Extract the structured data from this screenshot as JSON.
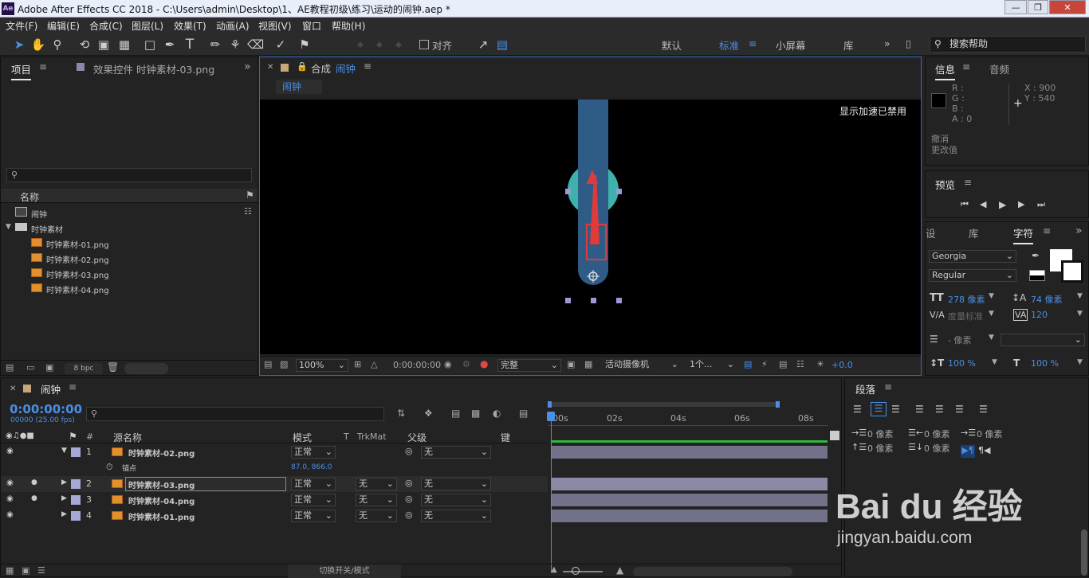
{
  "window": {
    "title": "Adobe After Effects CC 2018 - C:\\Users\\admin\\Desktop\\1、AE教程初级\\练习\\运动的闹钟.aep *",
    "logo": "Ae"
  },
  "menu": [
    "文件(F)",
    "编辑(E)",
    "合成(C)",
    "图层(L)",
    "效果(T)",
    "动画(A)",
    "视图(V)",
    "窗口",
    "帮助(H)"
  ],
  "toolbar": {
    "align_label": "对齐",
    "workspaces": [
      "默认",
      "标准",
      "小屏幕",
      "库"
    ],
    "active_workspace": "标准",
    "search_placeholder": "搜索帮助"
  },
  "project": {
    "tab_project": "项目",
    "tab_effects": "效果控件 时钟素材-03.png",
    "col_name": "名称",
    "items": [
      {
        "name": "闹钟",
        "type": "comp"
      },
      {
        "name": "时钟素材",
        "type": "folder"
      }
    ],
    "files": [
      "时钟素材-01.png",
      "时钟素材-02.png",
      "时钟素材-03.png",
      "时钟素材-04.png"
    ],
    "bpc": "8 bpc"
  },
  "comp": {
    "tab_prefix": "合成",
    "tab_name": "闹钟",
    "breadcrumb": "闹钟",
    "accel_notice": "显示加速已禁用",
    "zoom": "100%",
    "timecode": "0:00:00:00",
    "quality": "完整",
    "camera": "活动摄像机",
    "views": "1个...",
    "exposure": "+0.0"
  },
  "info": {
    "tab_info": "信息",
    "tab_audio": "音频",
    "r": "R :",
    "g": "G :",
    "b": "B :",
    "a": "A :  0",
    "x": "X : 900",
    "y": "Y : 540",
    "undo": "撤消",
    "undo_detail": "更改值"
  },
  "preview": {
    "title": "预览"
  },
  "character": {
    "tab_set": "设",
    "tab_lib": "库",
    "tab_char": "字符",
    "font": "Georgia",
    "style": "Regular",
    "size": "278 像素",
    "leading": "74 像素",
    "kerning": "度量标准",
    "tracking": "120",
    "stroke": "- 像素",
    "vscale": "100 %",
    "hscale": "100 %"
  },
  "paragraph": {
    "title": "段落",
    "indent1": "0 像素",
    "indent2": "0 像素",
    "indent3": "0 像素",
    "space1": "0 像素",
    "space2": "0 像素"
  },
  "timeline": {
    "tab": "闹钟",
    "timecode": "0:00:00:00",
    "fps": "00000 (25.00 fps)",
    "col_num": "#",
    "col_source": "源名称",
    "col_mode": "模式",
    "col_t": "T",
    "col_trkmat": "TrkMat",
    "col_parent": "父级",
    "col_key": "键",
    "ruler": [
      "00s",
      "02s",
      "04s",
      "06s",
      "08s"
    ],
    "footer": "切换开关/模式",
    "layers": [
      {
        "num": "1",
        "name": "时钟素材-02.png",
        "mode": "正常",
        "trkmat": "",
        "parent": "无",
        "expanded": true
      },
      {
        "num": "2",
        "name": "时钟素材-03.png",
        "mode": "正常",
        "trkmat": "无",
        "parent": "无",
        "selected": true
      },
      {
        "num": "3",
        "name": "时钟素材-04.png",
        "mode": "正常",
        "trkmat": "无",
        "parent": "无"
      },
      {
        "num": "4",
        "name": "时钟素材-01.png",
        "mode": "正常",
        "trkmat": "无",
        "parent": "无"
      }
    ],
    "prop": {
      "name": "锚点",
      "value": "87.0, 866.0"
    }
  },
  "watermark": {
    "brand": "Bai du 经验",
    "url": "jingyan.baidu.com"
  },
  "colors": {
    "accent": "#4b8ee6",
    "layer_color": "#a8a8d8",
    "bar": "#72718a",
    "arrow": "#e03a3a",
    "shape": "#2f5c87"
  }
}
